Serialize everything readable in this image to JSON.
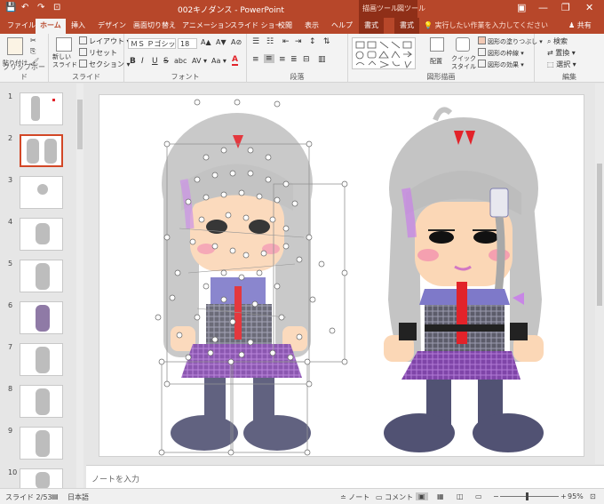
{
  "titlebar": {
    "doc_title": "002キノダンス - PowerPoint",
    "context_drawing_label": "描画ツール",
    "context_picture_label": "図ツール",
    "save_glyph": "💾",
    "undo_glyph": "↶",
    "redo_glyph": "↷",
    "present_glyph": "⊡",
    "minimize": "—",
    "restore": "❐",
    "close": "✕",
    "ribbon_options": "▣"
  },
  "tabs": [
    {
      "label": "ファイル"
    },
    {
      "label": "ホーム"
    },
    {
      "label": "挿入"
    },
    {
      "label": "デザイン"
    },
    {
      "label": "画面切り替え"
    },
    {
      "label": "アニメーション"
    },
    {
      "label": "スライド ショー"
    },
    {
      "label": "校閲"
    },
    {
      "label": "表示"
    },
    {
      "label": "ヘルプ"
    },
    {
      "label": "書式"
    },
    {
      "label": "書式"
    }
  ],
  "tell_me": "💡 実行したい作業を入力してください",
  "share": "共有",
  "ribbon": {
    "clipboard": {
      "paste": "貼り付け",
      "label": "クリップボード"
    },
    "slides": {
      "new_slide": "新しい\nスライド",
      "layout": "レイアウト ▾",
      "reset": "リセット",
      "section": "セクション ▾",
      "label": "スライド"
    },
    "font": {
      "name": "ＭＳ Ｐゴシック",
      "size": "18",
      "bold": "B",
      "italic": "I",
      "underline": "U",
      "strike": "S",
      "shadow": "abc",
      "spacing": "AV ▾",
      "case": "Aa ▾",
      "label": "フォント",
      "grow": "A▲",
      "shrink": "A▼",
      "clear": "A⊘",
      "color": "A"
    },
    "paragraph": {
      "label": "段落"
    },
    "drawing": {
      "arrange": "配置",
      "quick_style": "クイック\nスタイル",
      "fill": "図形の塗りつぶし ▾",
      "outline": "図形の枠線 ▾",
      "effects": "図形の効果 ▾",
      "label": "図形描画"
    },
    "editing": {
      "find": "検索",
      "replace": "置換 ▾",
      "select": "選択 ▾",
      "label": "編集"
    }
  },
  "thumbnails": [
    {
      "num": "1",
      "active": false
    },
    {
      "num": "2",
      "active": true
    },
    {
      "num": "3",
      "active": false
    },
    {
      "num": "4",
      "active": false
    },
    {
      "num": "5",
      "active": false
    },
    {
      "num": "6",
      "active": false
    },
    {
      "num": "7",
      "active": false
    },
    {
      "num": "8",
      "active": false
    },
    {
      "num": "9",
      "active": false
    },
    {
      "num": "10",
      "active": false
    }
  ],
  "notes_placeholder": "ノートを入力",
  "status": {
    "slide_of": "スライド 2/53",
    "language": "日本語",
    "notes": "ノート",
    "comments": "コメント",
    "zoom": "95%",
    "zoom_minus": "−",
    "zoom_plus": "+"
  },
  "colors": {
    "accent": "#b7472a",
    "accent_dark": "#8f2f18",
    "hair": "#bdbdbd",
    "shoe": "#515273",
    "skin": "#fbd7b6",
    "purple": "#a35ac5",
    "ribbon_red": "#e2232a"
  }
}
